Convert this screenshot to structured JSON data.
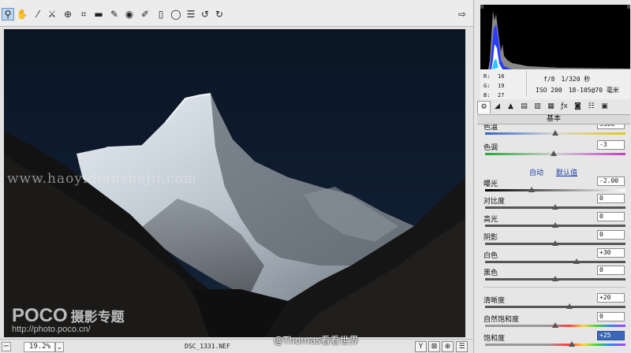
{
  "toolbar": {
    "tools": [
      {
        "icon": "zoom-icon",
        "glyph": "⚲",
        "active": true
      },
      {
        "icon": "hand-icon",
        "glyph": "✋"
      },
      {
        "icon": "white-balance-icon",
        "glyph": "⁄"
      },
      {
        "icon": "color-sampler-icon",
        "glyph": "⚔"
      },
      {
        "icon": "target-adjust-icon",
        "glyph": "⊕"
      },
      {
        "icon": "crop-icon",
        "glyph": "⌗"
      },
      {
        "icon": "straighten-icon",
        "glyph": "▬"
      },
      {
        "icon": "spot-removal-icon",
        "glyph": "✎"
      },
      {
        "icon": "red-eye-icon",
        "glyph": "◉"
      },
      {
        "icon": "adjustment-brush-icon",
        "glyph": "✐"
      },
      {
        "icon": "graduated-filter-icon",
        "glyph": "▯"
      },
      {
        "icon": "radial-filter-icon",
        "glyph": "◯"
      },
      {
        "icon": "preferences-icon",
        "glyph": "☰"
      },
      {
        "icon": "rotate-left-icon",
        "glyph": "↺"
      },
      {
        "icon": "rotate-right-icon",
        "glyph": "↻"
      }
    ],
    "export_icon": "⇨"
  },
  "photo": {
    "watermark_url": "www.haoyidianshejii.com",
    "poco_logo": "POCO",
    "poco_title": "摄影专题",
    "poco_url": "http://photo.poco.cn/"
  },
  "status": {
    "minus": "−",
    "zoom": "19.2%",
    "zoom_arrow": "⌄",
    "filename": "DSC_1331.NEF",
    "credit": "@Thomas看看世界",
    "buttons": [
      "Y",
      "⊠",
      "⊕",
      "☰"
    ]
  },
  "panel": {
    "rgb": {
      "r_label": "R:",
      "r": "16",
      "g_label": "G:",
      "g": "19",
      "b_label": "B:",
      "b": "27"
    },
    "exif": {
      "aperture": "f/8",
      "shutter": "1/320 秒",
      "iso": "ISO 200",
      "lens": "18-105@70 毫米"
    },
    "tabs": [
      "⚙",
      "◢",
      "▲",
      "▤",
      "▥",
      "▦",
      "ƒx",
      "◙",
      "☷",
      "▣"
    ],
    "section": "基本",
    "auto": "自动",
    "default": "默认值",
    "sliders": {
      "temp": {
        "label": "色温",
        "value": "5500",
        "pos": 0.5
      },
      "tint": {
        "label": "色调",
        "value": "-3",
        "pos": 0.49
      },
      "exposure": {
        "label": "曝光",
        "value": "-2.00",
        "pos": 0.33
      },
      "contrast": {
        "label": "对比度",
        "value": "0",
        "pos": 0.5
      },
      "highlights": {
        "label": "高光",
        "value": "0",
        "pos": 0.5
      },
      "shadows": {
        "label": "阴影",
        "value": "0",
        "pos": 0.5
      },
      "whites": {
        "label": "白色",
        "value": "+30",
        "pos": 0.65
      },
      "blacks": {
        "label": "黑色",
        "value": "0",
        "pos": 0.5
      },
      "clarity": {
        "label": "清晰度",
        "value": "+20",
        "pos": 0.6
      },
      "vibrance": {
        "label": "自然饱和度",
        "value": "0",
        "pos": 0.5
      },
      "saturation": {
        "label": "饱和度",
        "value": "+25",
        "pos": 0.62
      }
    }
  }
}
